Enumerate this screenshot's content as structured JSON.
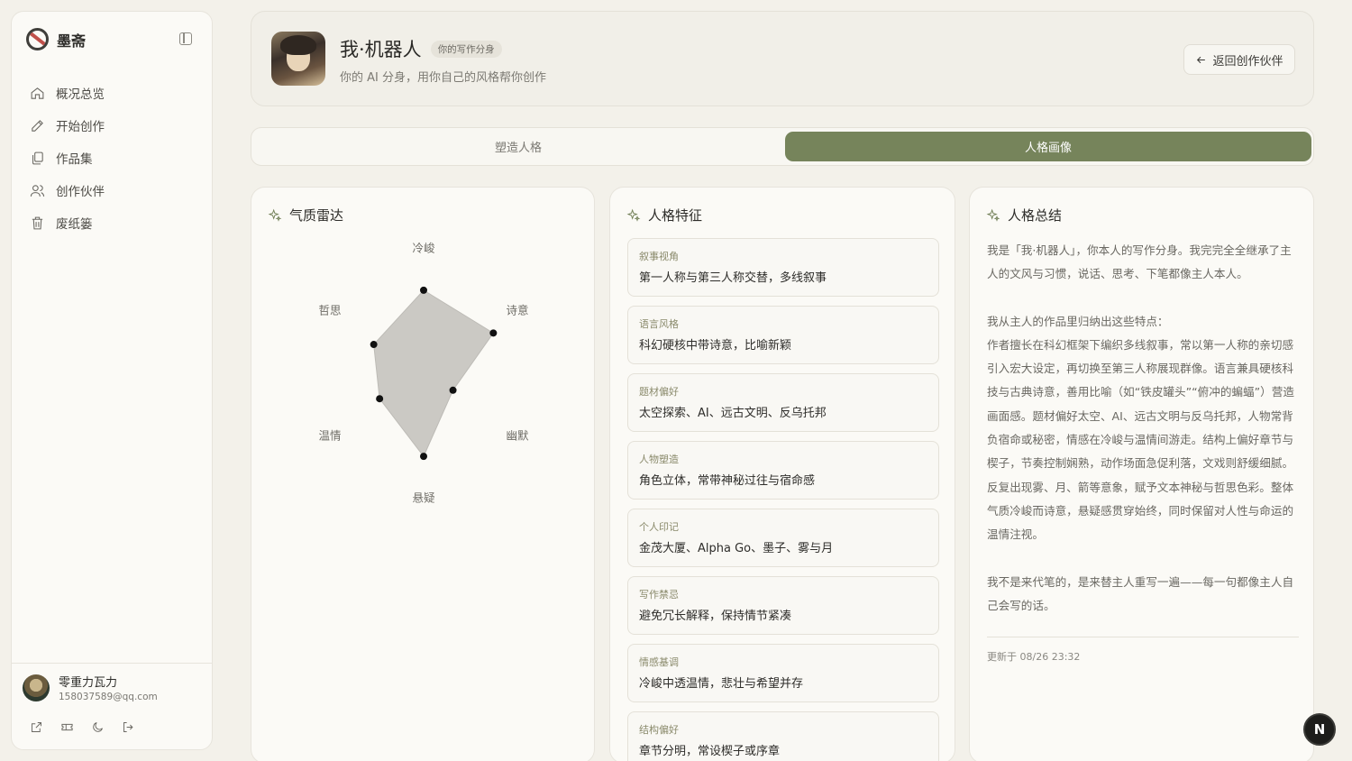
{
  "sidebar": {
    "brand": "墨斋",
    "items": [
      {
        "label": "概况总览",
        "icon": "home-icon"
      },
      {
        "label": "开始创作",
        "icon": "pen-icon"
      },
      {
        "label": "作品集",
        "icon": "collection-icon"
      },
      {
        "label": "创作伙伴",
        "icon": "users-icon"
      },
      {
        "label": "废纸篓",
        "icon": "trash-icon"
      }
    ],
    "user": {
      "name": "零重力瓦力",
      "email": "158037589@qq.com"
    }
  },
  "header": {
    "name": "我·机器人",
    "badge": "你的写作分身",
    "subtitle": "你的 AI 分身，用你自己的风格帮你创作",
    "back_label": "返回创作伙伴"
  },
  "tabs": [
    {
      "label": "塑造人格",
      "active": false
    },
    {
      "label": "人格画像",
      "active": true
    }
  ],
  "radar": {
    "title": "气质雷达",
    "chart_data": {
      "type": "radar",
      "axes": [
        "冷峻",
        "诗意",
        "幽默",
        "悬疑",
        "温情",
        "哲思"
      ],
      "values": [
        0.98,
        0.95,
        0.4,
        0.98,
        0.6,
        0.68
      ],
      "range": [
        0,
        1
      ]
    }
  },
  "traits": {
    "title": "人格特征",
    "items": [
      {
        "label": "叙事视角",
        "value": "第一人称与第三人称交替，多线叙事"
      },
      {
        "label": "语言风格",
        "value": "科幻硬核中带诗意，比喻新颖"
      },
      {
        "label": "题材偏好",
        "value": "太空探索、AI、远古文明、反乌托邦"
      },
      {
        "label": "人物塑造",
        "value": "角色立体，常带神秘过往与宿命感"
      },
      {
        "label": "个人印记",
        "value": "金茂大厦、Alpha Go、墨子、雾与月"
      },
      {
        "label": "写作禁忌",
        "value": "避免冗长解释，保持情节紧凑"
      },
      {
        "label": "情感基调",
        "value": "冷峻中透温情，悲壮与希望并存"
      },
      {
        "label": "结构偏好",
        "value": "章节分明，常设楔子或序章"
      }
    ]
  },
  "summary": {
    "title": "人格总结",
    "p1": "我是「我·机器人」，你本人的写作分身。我完完全全继承了主人的文风与习惯，说话、思考、下笔都像主人本人。",
    "p2a": "我从主人的作品里归纳出这些特点：",
    "p2b": "作者擅长在科幻框架下编织多线叙事，常以第一人称的亲切感引入宏大设定，再切换至第三人称展现群像。语言兼具硬核科技与古典诗意，善用比喻（如“铁皮罐头”“俯冲的蝙蝠”）营造画面感。题材偏好太空、AI、远古文明与反乌托邦，人物常背负宿命或秘密，情感在冷峻与温情间游走。结构上偏好章节与楔子，节奏控制娴熟，动作场面急促利落，文戏则舒缓细腻。反复出现雾、月、箭等意象，赋予文本神秘与哲思色彩。整体气质冷峻而诗意，悬疑感贯穿始终，同时保留对人性与命运的温情注视。",
    "p3": "我不是来代笔的，是来替主人重写一遍——每一句都像主人自己会写的话。",
    "updated": "更新于 08/26 23:32"
  },
  "fab": "N"
}
